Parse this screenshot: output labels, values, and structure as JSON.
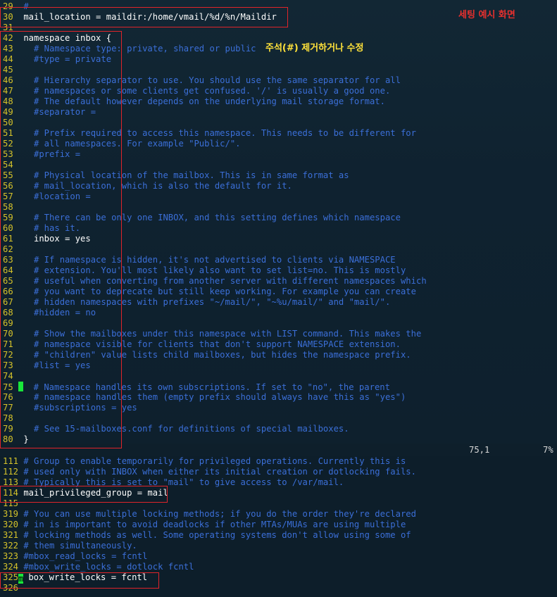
{
  "annotations": {
    "example_label": "세팅 예시 화면",
    "edit_instruction": "주석(#) 제거하거나 수정"
  },
  "colors": {
    "line_number": "#d4c22a",
    "comment": "#3b6fd8",
    "code": "#ffffff",
    "highlight_box": "#e0242a",
    "cursor": "#19e63a"
  },
  "top_lines": [
    {
      "n": "29",
      "text": "#",
      "type": "comment"
    },
    {
      "n": "30",
      "text": "mail_location = maildir:/home/vmail/%d/%n/Maildir",
      "type": "code"
    },
    {
      "n": "31",
      "text": "",
      "type": "code"
    },
    {
      "n": "42",
      "text": "namespace inbox {",
      "type": "code"
    },
    {
      "n": "43",
      "text": "  # Namespace type: private, shared or public",
      "type": "comment"
    },
    {
      "n": "44",
      "text": "  #type = private",
      "type": "comment"
    },
    {
      "n": "45",
      "text": "",
      "type": "code"
    },
    {
      "n": "46",
      "text": "  # Hierarchy separator to use. You should use the same separator for all",
      "type": "comment"
    },
    {
      "n": "47",
      "text": "  # namespaces or some clients get confused. '/' is usually a good one.",
      "type": "comment"
    },
    {
      "n": "48",
      "text": "  # The default however depends on the underlying mail storage format.",
      "type": "comment"
    },
    {
      "n": "49",
      "text": "  #separator =",
      "type": "comment"
    },
    {
      "n": "50",
      "text": "",
      "type": "code"
    },
    {
      "n": "51",
      "text": "  # Prefix required to access this namespace. This needs to be different for",
      "type": "comment"
    },
    {
      "n": "52",
      "text": "  # all namespaces. For example \"Public/\".",
      "type": "comment"
    },
    {
      "n": "53",
      "text": "  #prefix =",
      "type": "comment"
    },
    {
      "n": "54",
      "text": "",
      "type": "code"
    },
    {
      "n": "55",
      "text": "  # Physical location of the mailbox. This is in same format as",
      "type": "comment"
    },
    {
      "n": "56",
      "text": "  # mail_location, which is also the default for it.",
      "type": "comment"
    },
    {
      "n": "57",
      "text": "  #location =",
      "type": "comment"
    },
    {
      "n": "58",
      "text": "",
      "type": "code"
    },
    {
      "n": "59",
      "text": "  # There can be only one INBOX, and this setting defines which namespace",
      "type": "comment"
    },
    {
      "n": "60",
      "text": "  # has it.",
      "type": "comment"
    },
    {
      "n": "61",
      "text": "  inbox = yes",
      "type": "code"
    },
    {
      "n": "62",
      "text": "",
      "type": "code"
    },
    {
      "n": "63",
      "text": "  # If namespace is hidden, it's not advertised to clients via NAMESPACE",
      "type": "comment"
    },
    {
      "n": "64",
      "text": "  # extension. You'll most likely also want to set list=no. This is mostly",
      "type": "comment"
    },
    {
      "n": "65",
      "text": "  # useful when converting from another server with different namespaces which",
      "type": "comment"
    },
    {
      "n": "66",
      "text": "  # you want to deprecate but still keep working. For example you can create",
      "type": "comment"
    },
    {
      "n": "67",
      "text": "  # hidden namespaces with prefixes \"~/mail/\", \"~%u/mail/\" and \"mail/\".",
      "type": "comment"
    },
    {
      "n": "68",
      "text": "  #hidden = no",
      "type": "comment"
    },
    {
      "n": "69",
      "text": "",
      "type": "code"
    },
    {
      "n": "70",
      "text": "  # Show the mailboxes under this namespace with LIST command. This makes the",
      "type": "comment"
    },
    {
      "n": "71",
      "text": "  # namespace visible for clients that don't support NAMESPACE extension.",
      "type": "comment"
    },
    {
      "n": "72",
      "text": "  # \"children\" value lists child mailboxes, but hides the namespace prefix.",
      "type": "comment"
    },
    {
      "n": "73",
      "text": "  #list = yes",
      "type": "comment"
    },
    {
      "n": "74",
      "text": "",
      "type": "code"
    },
    {
      "n": "75",
      "text": "  # Namespace handles its own subscriptions. If set to \"no\", the parent",
      "type": "comment",
      "cursor": true
    },
    {
      "n": "76",
      "text": "  # namespace handles them (empty prefix should always have this as \"yes\")",
      "type": "comment"
    },
    {
      "n": "77",
      "text": "  #subscriptions = yes",
      "type": "comment"
    },
    {
      "n": "78",
      "text": "",
      "type": "code"
    },
    {
      "n": "79",
      "text": "  # See 15-mailboxes.conf for definitions of special mailboxes.",
      "type": "comment"
    },
    {
      "n": "80",
      "text": "}",
      "type": "code"
    }
  ],
  "status": {
    "position": "75,1",
    "percent": "7%"
  },
  "bottom_lines": [
    {
      "n": "111",
      "text": "# Group to enable temporarily for privileged operations. Currently this is",
      "type": "comment"
    },
    {
      "n": "112",
      "text": "# used only with INBOX when either its initial creation or dotlocking fails.",
      "type": "comment"
    },
    {
      "n": "113",
      "text": "# Typically this is set to \"mail\" to give access to /var/mail.",
      "type": "comment"
    },
    {
      "n": "114",
      "text": "mail_privileged_group = mail",
      "type": "code"
    },
    {
      "n": "115",
      "text": "",
      "type": "code"
    },
    {
      "n": "319",
      "text": "# You can use multiple locking methods; if you do the order they're declared",
      "type": "comment"
    },
    {
      "n": "320",
      "text": "# in is important to avoid deadlocks if other MTAs/MUAs are using multiple",
      "type": "comment"
    },
    {
      "n": "321",
      "text": "# locking methods as well. Some operating systems don't allow using some of",
      "type": "comment"
    },
    {
      "n": "322",
      "text": "# them simultaneously.",
      "type": "comment"
    },
    {
      "n": "323",
      "text": "#mbox_read_locks = fcntl",
      "type": "comment"
    },
    {
      "n": "324",
      "text": "#mbox_write_locks = dotlock fcntl",
      "type": "comment"
    },
    {
      "n": "325",
      "text": "mbox_write_locks = fcntl",
      "type": "code",
      "cursor_first": true
    },
    {
      "n": "326",
      "text": "",
      "type": "code"
    }
  ]
}
